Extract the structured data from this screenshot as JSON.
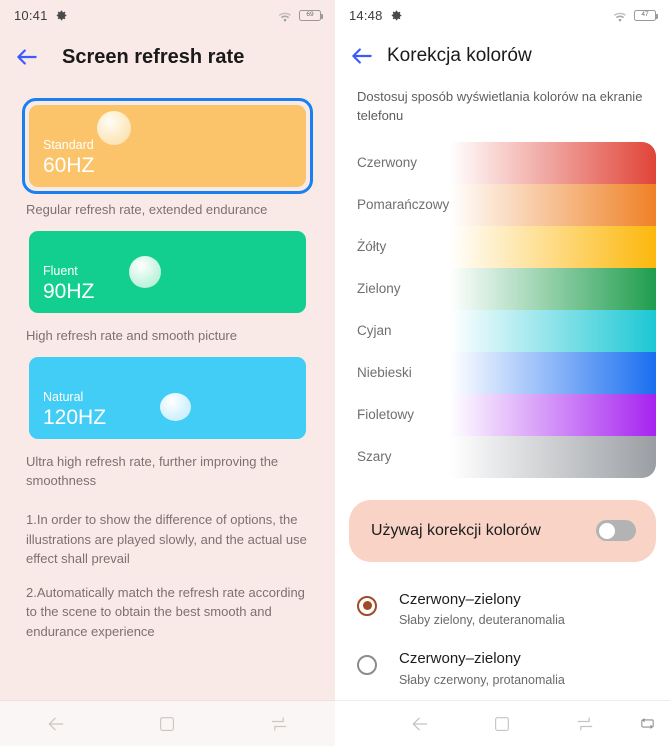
{
  "colors": {
    "left_bg": "#f9eae7",
    "right_bg": "#ffffff",
    "selection_border": "#1a80f0",
    "standard_card": "#fbc46a",
    "fluent_card": "#13cf8f",
    "natural_card": "#41cdf5",
    "toggle_card_bg": "#f9d3c6",
    "radio_accent": "#a04a28",
    "back_arrow": "#3b5bfd"
  },
  "left": {
    "status": {
      "time": "10:41",
      "gear_icon": "gear-icon",
      "wifi_icon": "wifi-icon",
      "battery_icon": "battery-icon",
      "battery_level": "69"
    },
    "title": "Screen refresh rate",
    "back_icon": "back-arrow-icon",
    "rates": [
      {
        "name": "Standard",
        "hz": "60HZ",
        "desc": "Regular refresh rate, extended endurance",
        "selected": true
      },
      {
        "name": "Fluent",
        "hz": "90HZ",
        "desc": "High refresh rate and smooth picture",
        "selected": false
      },
      {
        "name": "Natural",
        "hz": "120HZ",
        "desc": "Ultra high refresh rate, further improving the smoothness",
        "selected": false
      }
    ],
    "notes": [
      "1.In order to show the difference of options, the illustrations are played slowly, and the actual use effect shall prevail",
      "2.Automatically match the refresh rate according to the scene to obtain the best smooth and endurance experience"
    ],
    "nav": [
      {
        "icon": "nav-back-icon"
      },
      {
        "icon": "nav-home-icon"
      },
      {
        "icon": "nav-recents-icon"
      }
    ]
  },
  "right": {
    "status": {
      "time": "14:48",
      "gear_icon": "gear-icon",
      "wifi_icon": "wifi-icon",
      "battery_icon": "battery-icon",
      "battery_level": "47"
    },
    "title": "Korekcja kolorów",
    "back_icon": "back-arrow-icon",
    "intro": "Dostosuj sposób wyświetlania kolorów na ekranie telefonu",
    "colors": [
      {
        "label": "Czerwony",
        "hex": "#e04438"
      },
      {
        "label": "Pomarańczowy",
        "hex": "#ef8126"
      },
      {
        "label": "Żółty",
        "hex": "#fcb70b"
      },
      {
        "label": "Zielony",
        "hex": "#1f9d4e"
      },
      {
        "label": "Cyjan",
        "hex": "#1bc7d4"
      },
      {
        "label": "Niebieski",
        "hex": "#1a6ef0"
      },
      {
        "label": "Fioletowy",
        "hex": "#a623f0"
      },
      {
        "label": "Szary",
        "hex": "#9a9ea3"
      }
    ],
    "toggle": {
      "label": "Używaj korekcji kolorów",
      "state": "off"
    },
    "options": [
      {
        "title": "Czerwony–zielony",
        "sub": "Słaby zielony, deuteranomalia",
        "selected": true
      },
      {
        "title": "Czerwony–zielony",
        "sub": "Słaby czerwony, protanomalia",
        "selected": false
      }
    ],
    "nav": [
      {
        "icon": "nav-back-icon"
      },
      {
        "icon": "nav-home-icon"
      },
      {
        "icon": "nav-recents-icon"
      },
      {
        "icon": "rotate-screen-icon"
      }
    ]
  }
}
